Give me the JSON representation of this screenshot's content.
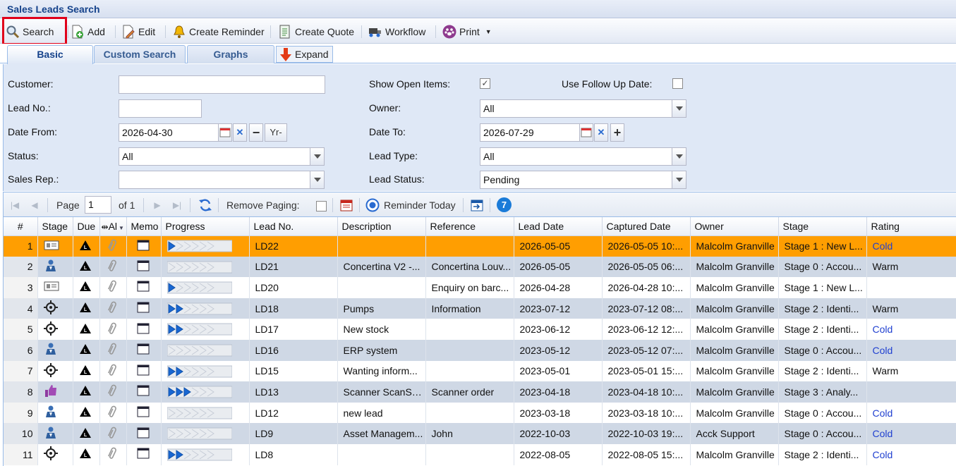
{
  "window": {
    "title": "Sales Leads Search"
  },
  "toolbar": {
    "search": "Search",
    "add": "Add",
    "edit": "Edit",
    "create_reminder": "Create Reminder",
    "create_quote": "Create Quote",
    "workflow": "Workflow",
    "print": "Print"
  },
  "tabs": {
    "basic": "Basic",
    "custom": "Custom Search",
    "graphs": "Graphs",
    "expand": "Expand"
  },
  "form": {
    "customer_label": "Customer:",
    "customer_value": "",
    "lead_no_label": "Lead No.:",
    "lead_no_value": "",
    "date_from_label": "Date From:",
    "date_from_value": "2026-04-30",
    "yr_label": "Yr-",
    "status_label": "Status:",
    "status_value": "All",
    "sales_rep_label": "Sales Rep.:",
    "sales_rep_value": "",
    "show_open_label": "Show Open Items:",
    "show_open_checked": true,
    "follow_up_label": "Use Follow Up Date:",
    "follow_up_checked": false,
    "owner_label": "Owner:",
    "owner_value": "All",
    "date_to_label": "Date To:",
    "date_to_value": "2026-07-29",
    "lead_type_label": "Lead Type:",
    "lead_type_value": "All",
    "lead_status_label": "Lead Status:",
    "lead_status_value": "Pending"
  },
  "pager": {
    "page_label": "Page",
    "page_value": "1",
    "of_label": "of 1",
    "remove_paging_label": "Remove Paging:",
    "reminder_today_label": "Reminder Today",
    "badge": "7"
  },
  "grid": {
    "columns": [
      "#",
      "Stage",
      "Due",
      "Al",
      "Memo",
      "Progress",
      "Lead No.",
      "Description",
      "Reference",
      "Lead Date",
      "Captured Date",
      "Owner",
      "Stage",
      "Rating"
    ],
    "rows": [
      {
        "n": "1",
        "stage_icon": "card-icon",
        "progress": 1,
        "lead": "LD22",
        "desc": "",
        "ref": "",
        "lead_date": "2026-05-05",
        "captured": "2026-05-05 10:...",
        "owner": "Malcolm Granville",
        "stage": "Stage 1 : New L...",
        "rating": "Cold"
      },
      {
        "n": "2",
        "stage_icon": "person-icon",
        "progress": 0,
        "lead": "LD21",
        "desc": "Concertina V2 -...",
        "ref": "Concertina Louv...",
        "lead_date": "2026-05-05",
        "captured": "2026-05-05 06:...",
        "owner": "Malcolm Granville",
        "stage": "Stage 0 : Accou...",
        "rating": "Warm"
      },
      {
        "n": "3",
        "stage_icon": "card-icon",
        "progress": 1,
        "lead": "LD20",
        "desc": "",
        "ref": "Enquiry on barc...",
        "lead_date": "2026-04-28",
        "captured": "2026-04-28 10:...",
        "owner": "Malcolm Granville",
        "stage": "Stage 1 : New L...",
        "rating": ""
      },
      {
        "n": "4",
        "stage_icon": "target-icon",
        "progress": 2,
        "lead": "LD18",
        "desc": "Pumps",
        "ref": "Information",
        "lead_date": "2023-07-12",
        "captured": "2023-07-12 08:...",
        "owner": "Malcolm Granville",
        "stage": "Stage 2 : Identi...",
        "rating": "Warm"
      },
      {
        "n": "5",
        "stage_icon": "target-icon",
        "progress": 2,
        "lead": "LD17",
        "desc": "New stock",
        "ref": "",
        "lead_date": "2023-06-12",
        "captured": "2023-06-12 12:...",
        "owner": "Malcolm Granville",
        "stage": "Stage 2 : Identi...",
        "rating": "Cold"
      },
      {
        "n": "6",
        "stage_icon": "person-icon",
        "progress": 0,
        "lead": "LD16",
        "desc": "ERP system",
        "ref": "",
        "lead_date": "2023-05-12",
        "captured": "2023-05-12 07:...",
        "owner": "Malcolm Granville",
        "stage": "Stage 0 : Accou...",
        "rating": "Cold"
      },
      {
        "n": "7",
        "stage_icon": "target-icon",
        "progress": 2,
        "lead": "LD15",
        "desc": "Wanting inform...",
        "ref": "",
        "lead_date": "2023-05-01",
        "captured": "2023-05-01 15:...",
        "owner": "Malcolm Granville",
        "stage": "Stage 2 : Identi...",
        "rating": "Warm"
      },
      {
        "n": "8",
        "stage_icon": "thumbs-up-icon",
        "progress": 3,
        "lead": "LD13",
        "desc": "Scanner ScanSKU",
        "ref": "Scanner order",
        "lead_date": "2023-04-18",
        "captured": "2023-04-18 10:...",
        "owner": "Malcolm Granville",
        "stage": "Stage 3 : Analy...",
        "rating": ""
      },
      {
        "n": "9",
        "stage_icon": "person-icon",
        "progress": 0,
        "lead": "LD12",
        "desc": "new lead",
        "ref": "",
        "lead_date": "2023-03-18",
        "captured": "2023-03-18 10:...",
        "owner": "Malcolm Granville",
        "stage": "Stage 0 : Accou...",
        "rating": "Cold"
      },
      {
        "n": "10",
        "stage_icon": "person-icon",
        "progress": 0,
        "lead": "LD9",
        "desc": "Asset Managem...",
        "ref": "John",
        "lead_date": "2022-10-03",
        "captured": "2022-10-03 19:...",
        "owner": "Acck Support",
        "stage": "Stage 0 : Accou...",
        "rating": "Cold"
      },
      {
        "n": "11",
        "stage_icon": "target-icon",
        "progress": 2,
        "lead": "LD8",
        "desc": "",
        "ref": "",
        "lead_date": "2022-08-05",
        "captured": "2022-08-05 15:...",
        "owner": "Malcolm Granville",
        "stage": "Stage 2 : Identi...",
        "rating": "Cold"
      }
    ]
  },
  "colors": {
    "selected_row": "#ff9e01",
    "alt_row": "#cfd8e5",
    "cold_rating": "#1f3fd0",
    "highlight_box": "#e0001a"
  }
}
